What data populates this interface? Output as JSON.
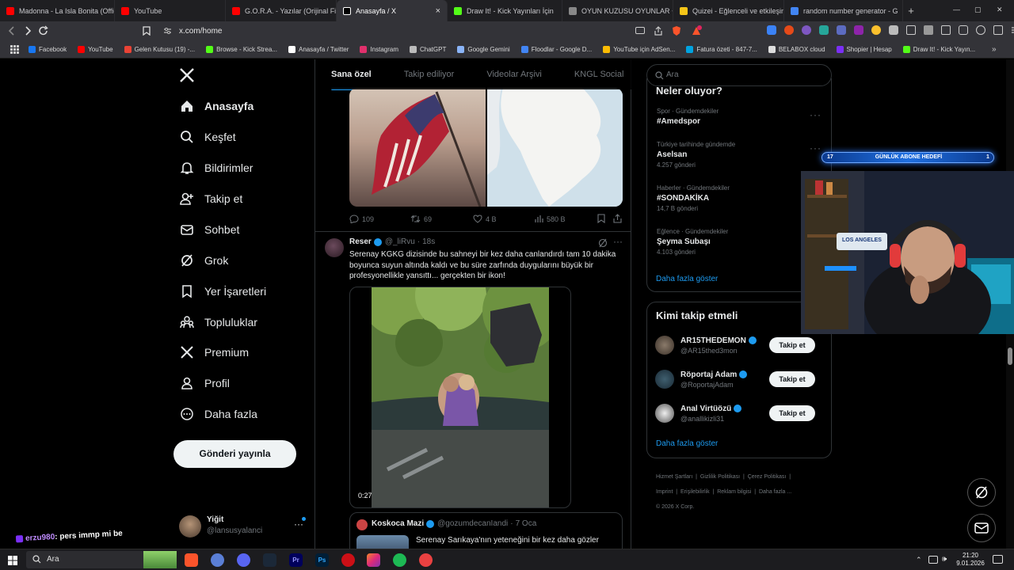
{
  "browser": {
    "tabs": [
      {
        "label": "Madonna - La Isla Bonita (Offic",
        "color": "#ff0000"
      },
      {
        "label": "YouTube",
        "color": "#ff0000"
      },
      {
        "label": "G.O.R.A. - Yazılar (Orijinal Film",
        "color": "#ff0000"
      },
      {
        "label": "Anasayfa / X",
        "color": "#000000",
        "active": true
      },
      {
        "label": "Draw It! - Kick Yayınları İçin",
        "color": "#53fc18"
      },
      {
        "label": "OYUN KUZUSU OYUNLAR ++",
        "color": "#888888"
      },
      {
        "label": "Quizei - Eğlenceli ve etkileşimli",
        "color": "#f5c518"
      },
      {
        "label": "random number generator - G",
        "color": "#4285f4"
      }
    ],
    "tab_close": "×",
    "new_tab": "+",
    "url": "x.com/home",
    "bookmarks": [
      {
        "label": "Facebook",
        "color": "#1877f2"
      },
      {
        "label": "YouTube",
        "color": "#ff0000"
      },
      {
        "label": "Gelen Kutusu (19) -...",
        "color": "#ea4335"
      },
      {
        "label": "Browse - Kick Strea...",
        "color": "#53fc18"
      },
      {
        "label": "Anasayfa / Twitter",
        "color": "#ffffff"
      },
      {
        "label": "Instagram",
        "color": "#e1306c"
      },
      {
        "label": "ChatGPT",
        "color": "#bbbbbb"
      },
      {
        "label": "Google Gemini",
        "color": "#8ab4f8"
      },
      {
        "label": "Floodlar - Google D...",
        "color": "#4285f4"
      },
      {
        "label": "YouTube için AdSen...",
        "color": "#fbbc04"
      },
      {
        "label": "Fatura özeti - 847-7...",
        "color": "#00a3e0"
      },
      {
        "label": "BELABOX cloud",
        "color": "#dddddd"
      },
      {
        "label": "Shopier | Hesap",
        "color": "#7b2ff7"
      },
      {
        "label": "Draw It! - Kick Yayın...",
        "color": "#53fc18"
      }
    ]
  },
  "sidebar": {
    "items": [
      {
        "label": "Anasayfa",
        "icon": "home-icon"
      },
      {
        "label": "Keşfet",
        "icon": "search-icon"
      },
      {
        "label": "Bildirimler",
        "icon": "bell-icon"
      },
      {
        "label": "Takip et",
        "icon": "person-add-icon"
      },
      {
        "label": "Sohbet",
        "icon": "mail-icon"
      },
      {
        "label": "Grok",
        "icon": "grok-icon"
      },
      {
        "label": "Yer İşaretleri",
        "icon": "bookmark-icon"
      },
      {
        "label": "Topluluklar",
        "icon": "communities-icon"
      },
      {
        "label": "Premium",
        "icon": "x-logo-icon"
      },
      {
        "label": "Profil",
        "icon": "profile-icon"
      },
      {
        "label": "Daha fazla",
        "icon": "more-circle-icon"
      }
    ],
    "post_button": "Gönderi yayınla",
    "account": {
      "name": "Yiğit",
      "handle": "@lansusyalanci"
    }
  },
  "feed": {
    "tabs": [
      "Sana özel",
      "Takip ediliyor",
      "Videolar Arşivi",
      "KNGL Social"
    ],
    "first_post_metrics": {
      "replies": "109",
      "reposts": "69",
      "likes": "4 B",
      "views": "580 B"
    },
    "post": {
      "author": "Reser",
      "handle": "@_liRvu",
      "time": "18s",
      "text": "Serenay KGKG dizisinde bu sahneyi bir kez daha canlandırdı tam 10 dakika boyunca suyun altında kaldı ve bu süre zarfında duygularını büyük bir profesyonellikle yansıttı... gerçekten bir ikon!",
      "video_duration": "0:27"
    },
    "quote": {
      "author": "Koskoca Mazi",
      "handle": "@gozumdecanIandi",
      "date": "7 Oca",
      "text": "Serenay Sarıkaya'nın yeteneğini bir kez daha gözler"
    }
  },
  "right": {
    "search_placeholder": "Ara",
    "trends_title": "Neler oluyor?",
    "trends": [
      {
        "category": "Spor · Gündemdekiler",
        "title": "#Amedspor",
        "count": ""
      },
      {
        "category": "Türkiye tarihinde gündemde",
        "title": "Aselsan",
        "count": "4.257 gönderi"
      },
      {
        "category": "Haberler · Gündemdekiler",
        "title": "#SONDAKİKA",
        "count": "14,7 B gönderi"
      },
      {
        "category": "Eğlence · Gündemdekiler",
        "title": "Şeyma Subaşı",
        "count": "4.103 gönderi"
      }
    ],
    "show_more": "Daha fazla göster",
    "who_title": "Kimi takip etmeli",
    "who": [
      {
        "name": "AR15THEDEMON",
        "handle": "@AR15thed3mon",
        "button": "Takip et"
      },
      {
        "name": "Röportaj Adam",
        "handle": "@RoportajAdam",
        "button": "Takip et"
      },
      {
        "name": "Anal Virtüözü",
        "handle": "@anallikizli31",
        "button": "Takip et"
      }
    ],
    "who_more": "Daha fazla göster",
    "footer": [
      "Hizmet Şartları",
      "Gizlilik Politikası",
      "Çerez Politikası",
      "Imprint",
      "Erişilebilirlik",
      "Reklam bilgisi",
      "Daha fazla ...",
      "© 2026 X Corp."
    ]
  },
  "overlay": {
    "goal_label": "GÜNLÜK ABONE HEDEFİ",
    "goal_current": "17",
    "goal_target": "1",
    "chat_user": "erzu980",
    "chat_message": ": pers immp mi be",
    "webcam_sign": "LOS ANGELES"
  },
  "taskbar": {
    "search": "Ara",
    "time": "21:20",
    "date": "9.01.2026"
  }
}
